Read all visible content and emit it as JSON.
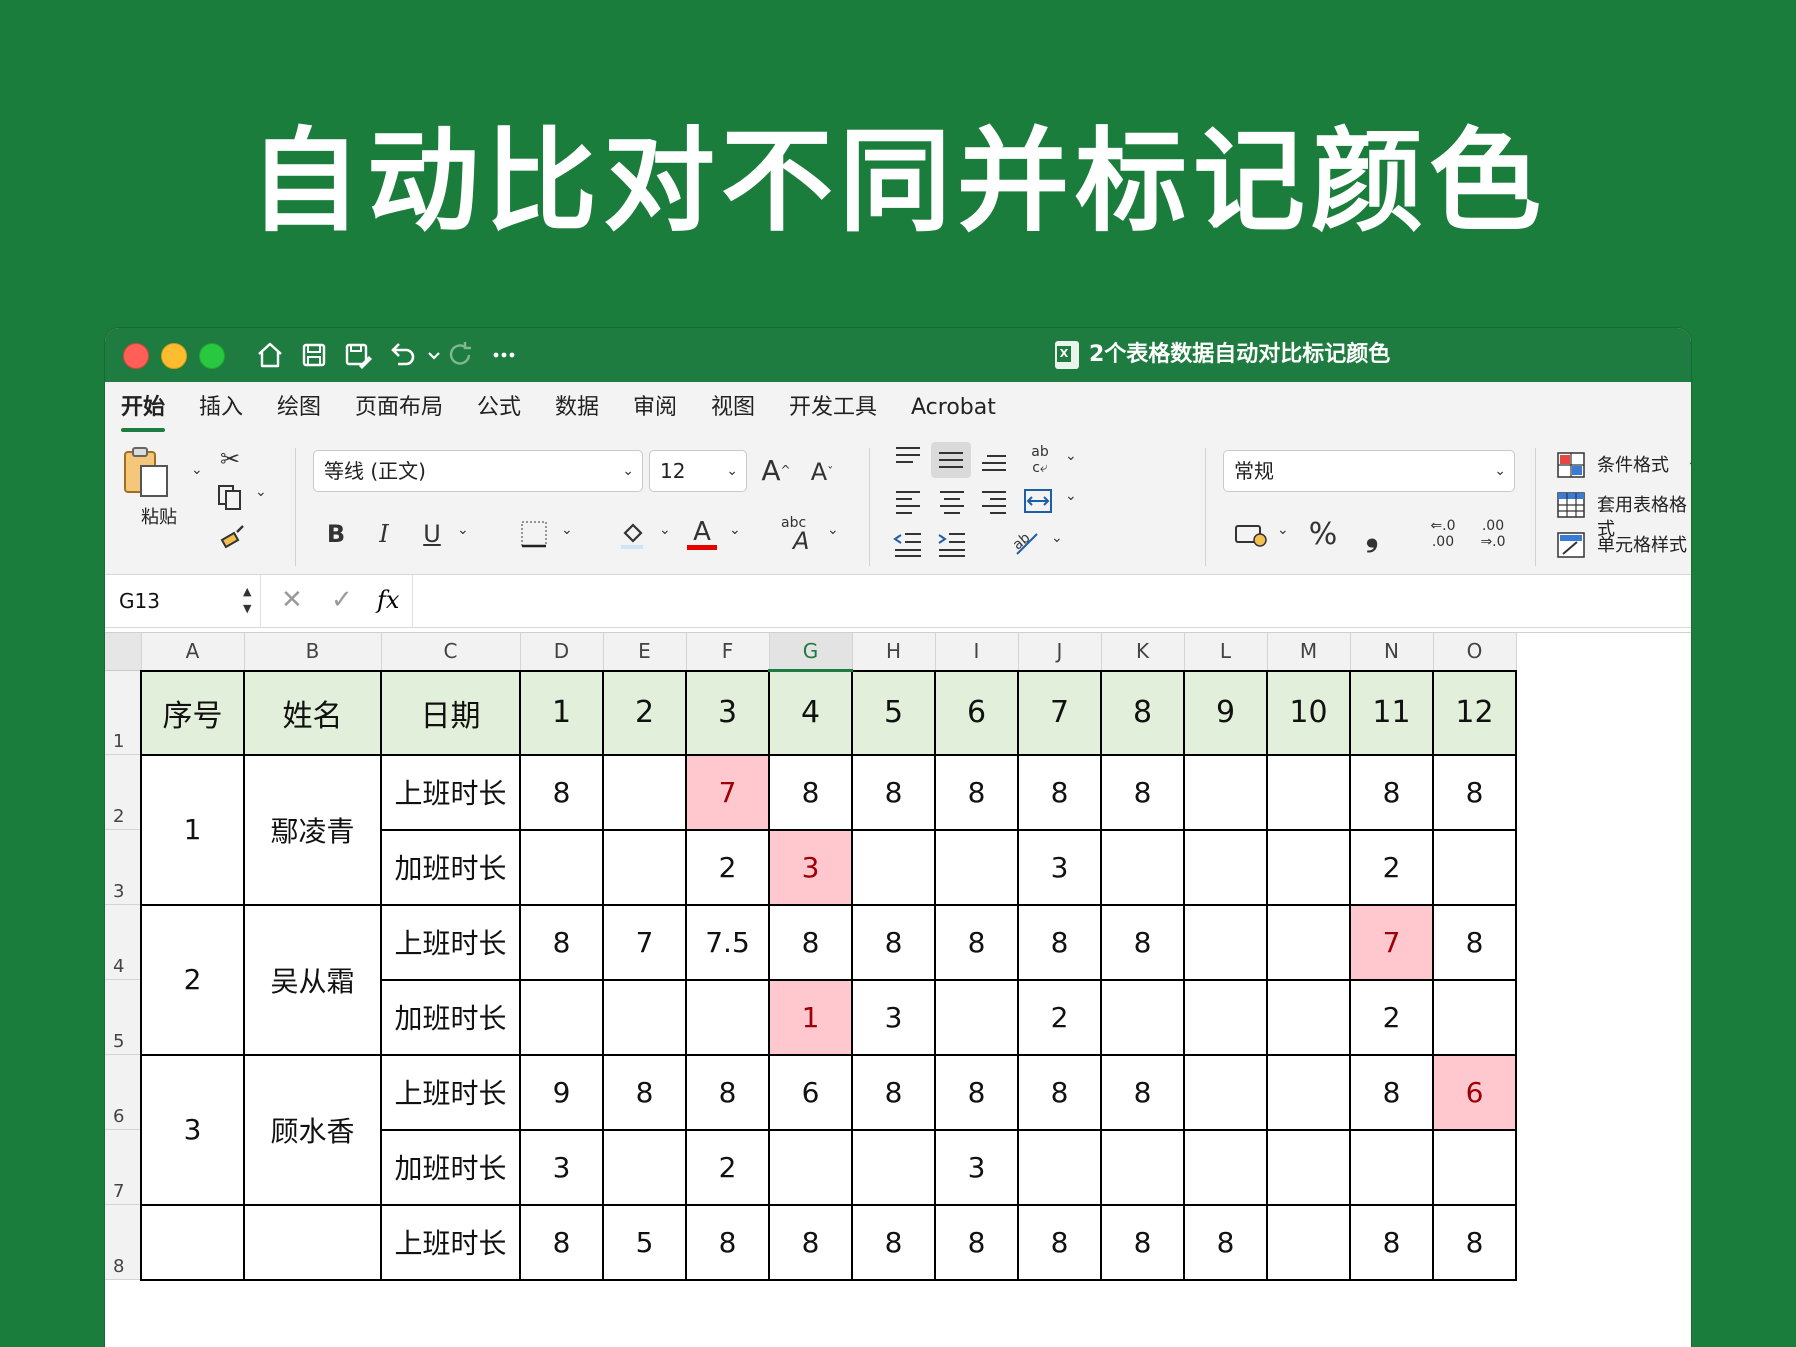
{
  "headline": "自动比对不同并标记颜色",
  "window": {
    "doc_title": "2个表格数据自动对比标记颜色",
    "tabs": [
      "开始",
      "插入",
      "绘图",
      "页面布局",
      "公式",
      "数据",
      "审阅",
      "视图",
      "开发工具",
      "Acrobat"
    ],
    "active_tab": "开始"
  },
  "ribbon": {
    "paste_label": "粘贴",
    "font_name": "等线 (正文)",
    "font_size": "12",
    "number_format": "常规",
    "styles": {
      "conditional": "条件格式",
      "table_format": "套用表格格式",
      "cell_styles": "单元格样式"
    },
    "colors": {
      "font_color": "#e60000",
      "highlight": "#ffc7ce",
      "highlight_text": "#9c0006",
      "header_fill": "#e2efda",
      "brand": "#1f7c40"
    }
  },
  "formula_bar": {
    "name_box": "G13",
    "fx": "fx"
  },
  "sheet": {
    "columns": [
      "A",
      "B",
      "C",
      "D",
      "E",
      "F",
      "G",
      "H",
      "I",
      "J",
      "K",
      "L",
      "M",
      "N",
      "O"
    ],
    "selected_column": "G",
    "row_numbers": [
      "1",
      "2",
      "3",
      "4",
      "5",
      "6",
      "7",
      "8"
    ],
    "header": {
      "seq": "序号",
      "name": "姓名",
      "date": "日期",
      "days": [
        "1",
        "2",
        "3",
        "4",
        "5",
        "6",
        "7",
        "8",
        "9",
        "10",
        "11",
        "12"
      ]
    },
    "people": [
      {
        "seq": "1",
        "name": "鄢凌青",
        "rows": [
          {
            "label": "上班时长",
            "values": [
              "8",
              "",
              "7",
              "8",
              "8",
              "8",
              "8",
              "8",
              "",
              "",
              "8",
              "8"
            ],
            "highlight": [
              false,
              false,
              true,
              false,
              false,
              false,
              false,
              false,
              false,
              false,
              false,
              false
            ]
          },
          {
            "label": "加班时长",
            "values": [
              "",
              "",
              "2",
              "3",
              "",
              "",
              "3",
              "",
              "",
              "",
              "2",
              ""
            ],
            "highlight": [
              false,
              false,
              false,
              true,
              false,
              false,
              false,
              false,
              false,
              false,
              false,
              false
            ]
          }
        ]
      },
      {
        "seq": "2",
        "name": "吴从霜",
        "rows": [
          {
            "label": "上班时长",
            "values": [
              "8",
              "7",
              "7.5",
              "8",
              "8",
              "8",
              "8",
              "8",
              "",
              "",
              "7",
              "8"
            ],
            "highlight": [
              false,
              false,
              false,
              false,
              false,
              false,
              false,
              false,
              false,
              false,
              true,
              false
            ]
          },
          {
            "label": "加班时长",
            "values": [
              "",
              "",
              "",
              "1",
              "3",
              "",
              "2",
              "",
              "",
              "",
              "2",
              ""
            ],
            "highlight": [
              false,
              false,
              false,
              true,
              false,
              false,
              false,
              false,
              false,
              false,
              false,
              false
            ]
          }
        ]
      },
      {
        "seq": "3",
        "name": "顾水香",
        "rows": [
          {
            "label": "上班时长",
            "values": [
              "9",
              "8",
              "8",
              "6",
              "8",
              "8",
              "8",
              "8",
              "",
              "",
              "8",
              "6"
            ],
            "highlight": [
              false,
              false,
              false,
              false,
              false,
              false,
              false,
              false,
              false,
              false,
              false,
              true
            ]
          },
          {
            "label": "加班时长",
            "values": [
              "3",
              "",
              "2",
              "",
              "",
              "3",
              "",
              "",
              "",
              "",
              "",
              ""
            ],
            "highlight": [
              false,
              false,
              false,
              false,
              false,
              false,
              false,
              false,
              false,
              false,
              false,
              false
            ]
          }
        ]
      },
      {
        "seq": "",
        "name": "",
        "rows": [
          {
            "label": "上班时长",
            "values": [
              "8",
              "5",
              "8",
              "8",
              "8",
              "8",
              "8",
              "8",
              "8",
              "",
              "8",
              "8"
            ],
            "highlight": [
              false,
              false,
              false,
              false,
              false,
              false,
              false,
              false,
              false,
              false,
              false,
              false
            ]
          }
        ]
      }
    ]
  }
}
